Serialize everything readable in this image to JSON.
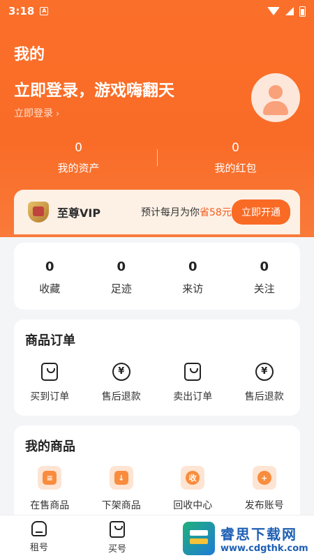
{
  "status_bar": {
    "time": "3:18",
    "notif": "A"
  },
  "header": {
    "title": "我的",
    "login_heading": "立即登录，游戏嗨翻天",
    "login_link": "立即登录",
    "login_chevron": "›"
  },
  "assets": [
    {
      "value": "0",
      "label": "我的资产"
    },
    {
      "value": "0",
      "label": "我的红包"
    }
  ],
  "vip": {
    "title": "至尊VIP",
    "desc_prefix": "预计每月为你",
    "desc_highlight": "省58元",
    "button": "立即开通"
  },
  "counts": [
    {
      "value": "0",
      "label": "收藏"
    },
    {
      "value": "0",
      "label": "足迹"
    },
    {
      "value": "0",
      "label": "来访"
    },
    {
      "value": "0",
      "label": "关注"
    }
  ],
  "orders": {
    "title": "商品订单",
    "items": [
      {
        "label": "买到订单",
        "icon": "bag-icon"
      },
      {
        "label": "售后退款",
        "icon": "yen-icon"
      },
      {
        "label": "卖出订单",
        "icon": "bag-icon"
      },
      {
        "label": "售后退款",
        "icon": "yen-icon"
      }
    ]
  },
  "my_goods": {
    "title": "我的商品",
    "items": [
      {
        "label": "在售商品",
        "icon": "list-icon",
        "glyph": "≡"
      },
      {
        "label": "下架商品",
        "icon": "download-icon",
        "glyph": "↓"
      },
      {
        "label": "回收中心",
        "icon": "recycle-icon",
        "glyph": "收"
      },
      {
        "label": "发布账号",
        "icon": "plus-icon",
        "glyph": "+"
      }
    ]
  },
  "tabbar": [
    {
      "label": "租号"
    },
    {
      "label": "买号"
    }
  ],
  "watermark": {
    "name": "睿思下载网",
    "url": "www.cdgthk.com"
  },
  "colors": {
    "accent": "#f96a25",
    "hero": "#fa6f2a",
    "vip_bg": "#fdf1e6"
  }
}
